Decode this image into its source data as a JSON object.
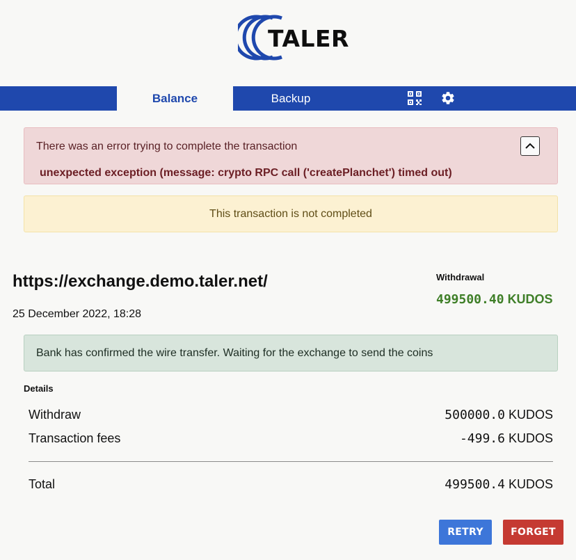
{
  "logo": {
    "text": "TALER"
  },
  "nav": {
    "tabs": [
      {
        "label": "Balance",
        "active": true
      },
      {
        "label": "Backup",
        "active": false
      }
    ],
    "icons": [
      "qr-code-icon",
      "gear-icon"
    ],
    "bar_color": "#1f48ad"
  },
  "error": {
    "title": "There was an error trying to complete the transaction",
    "message": "unexpected exception (message: crypto RPC call ('createPlanchet') timed out)",
    "toggle_icon": "chevron-up-icon"
  },
  "warning": {
    "text": "This transaction is not completed"
  },
  "transaction": {
    "exchange_url": "https://exchange.demo.taler.net/",
    "date": "25 December 2022, 18:28",
    "kind": "Withdrawal",
    "amount_value": "499500.40",
    "amount_currency": "KUDOS",
    "status_message": "Bank has confirmed the wire transfer. Waiting for the exchange to send the coins"
  },
  "details": {
    "label": "Details",
    "rows": [
      {
        "label": "Withdraw",
        "value": "500000.0",
        "currency": "KUDOS"
      },
      {
        "label": "Transaction fees",
        "value": "-499.6",
        "currency": "KUDOS"
      }
    ],
    "total": {
      "label": "Total",
      "value": "499500.4",
      "currency": "KUDOS"
    }
  },
  "actions": {
    "retry_label": "RETRY",
    "forget_label": "FORGET",
    "retry_color": "#3d76d9",
    "forget_color": "#c53a32"
  }
}
